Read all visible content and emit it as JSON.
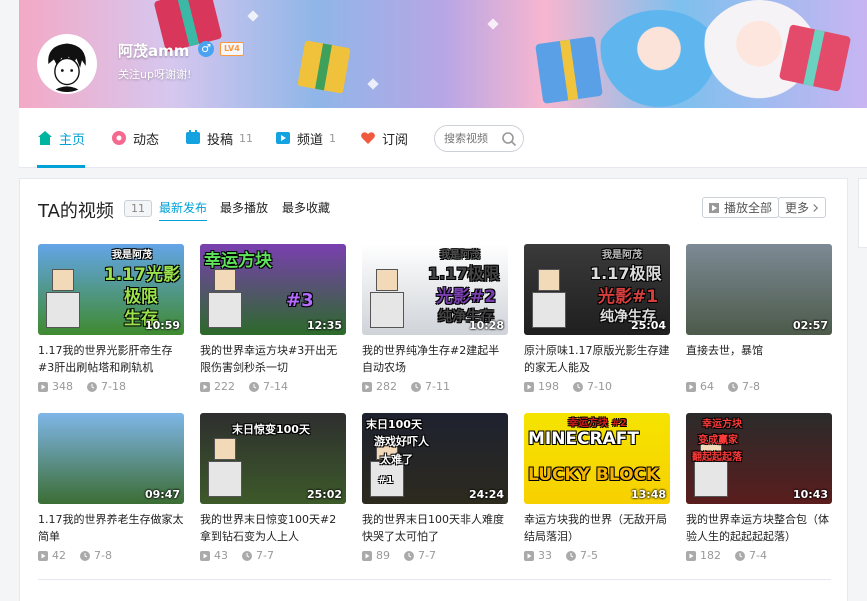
{
  "user": {
    "name": "阿茂amm",
    "gender": "♂",
    "level": "LV4",
    "sign": "关注up呀谢谢!"
  },
  "nav": {
    "home": "主页",
    "dynamic": "动态",
    "posts": "投稿",
    "posts_count": "11",
    "channel": "频道",
    "channel_count": "1",
    "subscribe": "订阅",
    "search_placeholder": "搜索视频"
  },
  "videos_section": {
    "title": "TA的视频",
    "count": "11",
    "sort_latest": "最新发布",
    "sort_play": "最多播放",
    "sort_fav": "最多收藏",
    "play_all": "播放全部",
    "more": "更多"
  },
  "videos": [
    {
      "title": "1.17我的世界光影肝帝生存#3肝出刷帖塔和刷轨机",
      "duration": "10:59",
      "views": "348",
      "date": "7-18",
      "overlay": [
        "我是阿茂",
        "1.17光影",
        "极限",
        "生存"
      ],
      "colors": [
        "#63a5e8",
        "#3f8a2e"
      ]
    },
    {
      "title": "我的世界幸运方块#3开出无限伤害剑秒杀一切",
      "duration": "12:35",
      "views": "222",
      "date": "7-14",
      "overlay": [
        "幸运方块",
        "#3"
      ],
      "colors": [
        "#7a3fb0",
        "#2c6a2a"
      ]
    },
    {
      "title": "我的世界纯净生存#2建起半自动农场",
      "duration": "10:28",
      "views": "282",
      "date": "7-11",
      "overlay": [
        "我是阿茂",
        "1.17极限",
        "光影#2",
        "纯净生存"
      ],
      "colors": [
        "#ffffff",
        "#cfd3d8"
      ]
    },
    {
      "title": "原汁原味1.17原版光影生存建的家无人能及",
      "duration": "25:04",
      "views": "198",
      "date": "7-10",
      "overlay": [
        "我是阿茂",
        "1.17极限",
        "光影#1",
        "纯净生存"
      ],
      "colors": [
        "#3a3a3a",
        "#1f1f1f"
      ]
    },
    {
      "title": "直接去世，暴馆",
      "duration": "02:57",
      "views": "64",
      "date": "7-8",
      "overlay": [],
      "colors": [
        "#7d8a95",
        "#4c5a4a"
      ]
    },
    {
      "title": "1.17我的世界养老生存做家太简单",
      "duration": "09:47",
      "views": "42",
      "date": "7-8",
      "overlay": [],
      "colors": [
        "#7fb6e8",
        "#3c6d34"
      ]
    },
    {
      "title": "我的世界末日惊变100天#2拿到钻石变为人上人",
      "duration": "25:02",
      "views": "43",
      "date": "7-7",
      "overlay": [
        "末日惊变100天"
      ],
      "colors": [
        "#2e2e2e",
        "#3d5a2a"
      ]
    },
    {
      "title": "我的世界末日100天非人难度快哭了太可怕了",
      "duration": "24:24",
      "views": "89",
      "date": "7-7",
      "overlay": [
        "末日100天",
        "游戏好吓人",
        "太难了",
        "#1"
      ],
      "colors": [
        "#1e2230",
        "#2d2a1e"
      ]
    },
    {
      "title": "幸运方块我的世界（无敌开局结局落泪）",
      "duration": "13:48",
      "views": "33",
      "date": "7-5",
      "overlay": [
        "幸运方块 #2",
        "MINECRAFT",
        "LUCKY BLOCK"
      ],
      "colors": [
        "#f5e400",
        "#f7d000"
      ]
    },
    {
      "title": "我的世界幸运方块整合包（体验人生的起起起起落）",
      "duration": "10:43",
      "views": "182",
      "date": "7-4",
      "overlay": [
        "幸运方块",
        "变成赢家",
        "翻起起起落"
      ],
      "colors": [
        "#2b2b2b",
        "#5a1d1d"
      ]
    }
  ]
}
